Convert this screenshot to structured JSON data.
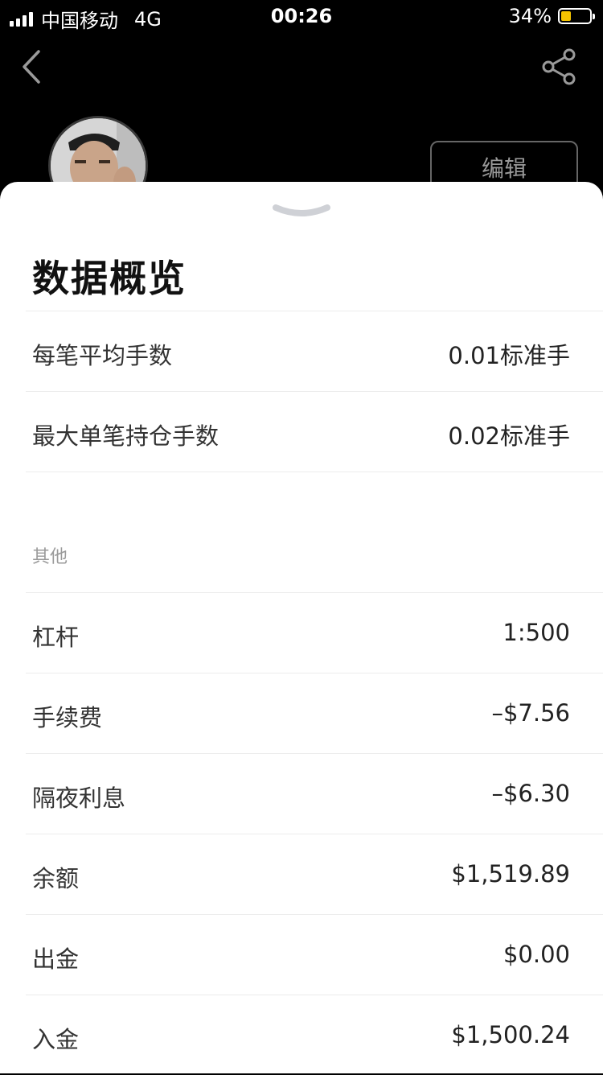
{
  "status_bar": {
    "carrier": "中国移动",
    "network": "4G",
    "time": "00:26",
    "battery": "34%",
    "battery_color": "#f5c400"
  },
  "header": {
    "edit_label": "编辑",
    "back_icon": "chevron-left-icon",
    "share_icon": "share-icon"
  },
  "sheet": {
    "title": "数据概览",
    "stats": [
      {
        "label": "每笔平均手数",
        "value": "0.01标准手"
      },
      {
        "label": "最大单笔持仓手数",
        "value": "0.02标准手"
      }
    ],
    "other_section_label": "其他",
    "other": [
      {
        "label": "杠杆",
        "value": "1:500"
      },
      {
        "label": "手续费",
        "value": "–$7.56"
      },
      {
        "label": "隔夜利息",
        "value": "–$6.30"
      },
      {
        "label": "余额",
        "value": "$1,519.89"
      },
      {
        "label": "出金",
        "value": "$0.00"
      },
      {
        "label": "入金",
        "value": "$1,500.24"
      }
    ]
  }
}
